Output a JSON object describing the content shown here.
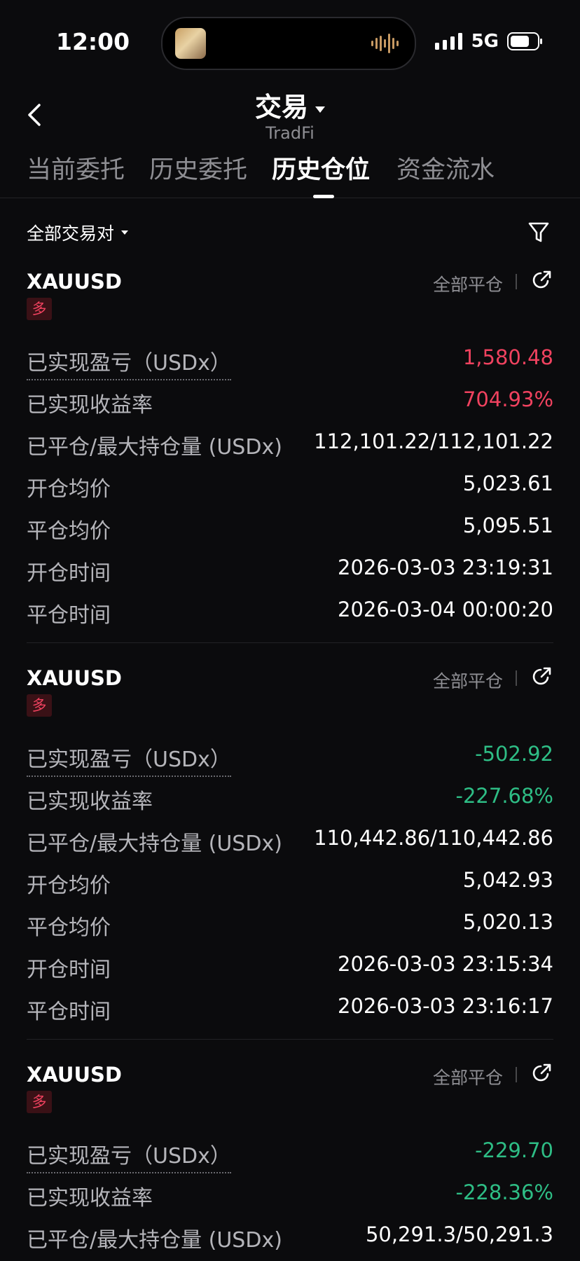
{
  "status_bar": {
    "time": "12:00",
    "network": "5G"
  },
  "header": {
    "title": "交易",
    "subtitle": "TradFi"
  },
  "tabs": [
    {
      "label": "当前委托",
      "active": false
    },
    {
      "label": "历史委托",
      "active": false
    },
    {
      "label": "历史仓位",
      "active": true
    },
    {
      "label": "资金流水",
      "active": false
    }
  ],
  "filter": {
    "pair_label": "全部交易对"
  },
  "colors": {
    "profit": "#f0425f",
    "loss": "#2ebd85",
    "background": "#0b0b0d"
  },
  "positions": [
    {
      "symbol": "XAUUSD",
      "side": "多",
      "close_all_label": "全部平仓",
      "pnl_label": "已实现盈亏（USDx）",
      "pnl": "1,580.48",
      "roi_label": "已实现收益率",
      "roi": "704.93%",
      "size_label": "已平仓/最大持仓量 (USDx)",
      "size": "112,101.22/112,101.22",
      "open_price_label": "开仓均价",
      "open_price": "5,023.61",
      "close_price_label": "平仓均价",
      "close_price": "5,095.51",
      "open_time_label": "开仓时间",
      "open_time": "2026-03-03 23:19:31",
      "close_time_label": "平仓时间",
      "close_time": "2026-03-04 00:00:20"
    },
    {
      "symbol": "XAUUSD",
      "side": "多",
      "close_all_label": "全部平仓",
      "pnl_label": "已实现盈亏（USDx）",
      "pnl": "-502.92",
      "roi_label": "已实现收益率",
      "roi": "-227.68%",
      "size_label": "已平仓/最大持仓量 (USDx)",
      "size": "110,442.86/110,442.86",
      "open_price_label": "开仓均价",
      "open_price": "5,042.93",
      "close_price_label": "平仓均价",
      "close_price": "5,020.13",
      "open_time_label": "开仓时间",
      "open_time": "2026-03-03 23:15:34",
      "close_time_label": "平仓时间",
      "close_time": "2026-03-03 23:16:17"
    },
    {
      "symbol": "XAUUSD",
      "side": "多",
      "close_all_label": "全部平仓",
      "pnl_label": "已实现盈亏（USDx）",
      "pnl": "-229.70",
      "roi_label": "已实现收益率",
      "roi": "-228.36%",
      "size_label": "已平仓/最大持仓量 (USDx)",
      "size": "50,291.3/50,291.3"
    }
  ]
}
